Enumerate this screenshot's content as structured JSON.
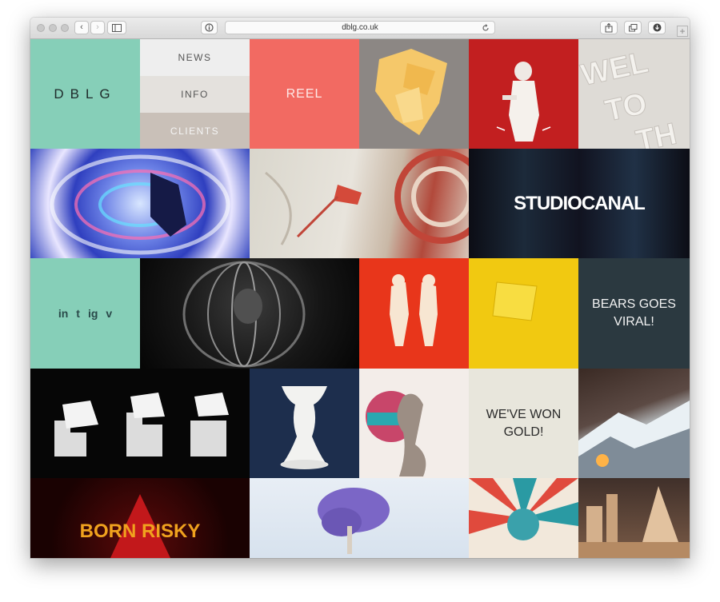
{
  "browser": {
    "url": "dblg.co.uk"
  },
  "site": {
    "logo": "DBLG",
    "nav": [
      "NEWS",
      "INFO",
      "CLIENTS"
    ],
    "reel": "REEL",
    "studiocanal": "STUDIOCANAL",
    "social": [
      "in",
      "t",
      "ig",
      "v"
    ],
    "bears_text": "BEARS GOES VIRAL!",
    "gold_text": "WE'VE WON GOLD!",
    "born_risky": "BORN RISKY"
  },
  "colors": {
    "mint": "#86cfb8",
    "coral": "#f26a62",
    "red": "#c21f20",
    "dark_slate": "#2b3940",
    "cream": "#e8e6dc",
    "studio_bg": "#12131d",
    "yellow": "#f1c911"
  }
}
